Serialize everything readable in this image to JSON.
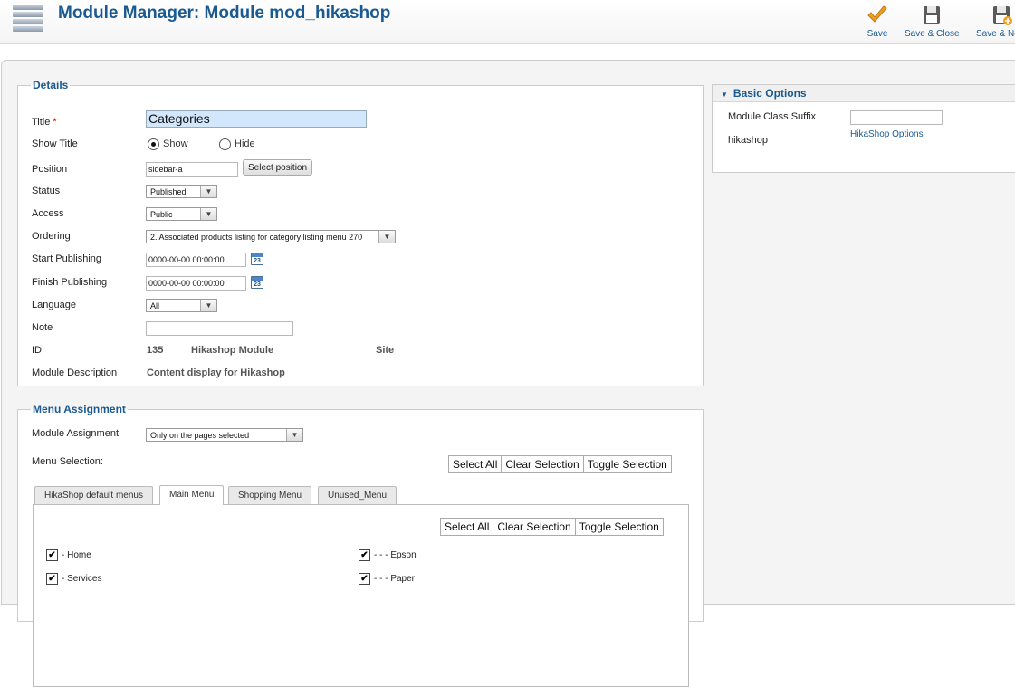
{
  "header": {
    "title": "Module Manager: Module mod_hikashop",
    "toolbar": {
      "save": "Save",
      "save_close": "Save & Close",
      "save_new": "Save & New"
    }
  },
  "details": {
    "legend": "Details",
    "title_label": "Title",
    "required_mark": "*",
    "title_value": "Categories",
    "show_title_label": "Show Title",
    "show_option": "Show",
    "hide_option": "Hide",
    "show_title_selected": "Show",
    "position_label": "Position",
    "position_value": "sidebar-a",
    "select_position_button": "Select position",
    "status_label": "Status",
    "status_value": "Published",
    "access_label": "Access",
    "access_value": "Public",
    "ordering_label": "Ordering",
    "ordering_value": "2. Associated products listing for category listing menu 270",
    "start_publishing_label": "Start Publishing",
    "start_publishing_value": "0000-00-00 00:00:00",
    "finish_publishing_label": "Finish Publishing",
    "finish_publishing_value": "0000-00-00 00:00:00",
    "calendar_day": "23",
    "language_label": "Language",
    "language_value": "All",
    "note_label": "Note",
    "note_value": "",
    "id_label": "ID",
    "id_value": "135",
    "module_name": "Hikashop Module",
    "module_client": "Site",
    "description_label": "Module Description",
    "description_value": "Content display for Hikashop"
  },
  "menu_assignment": {
    "legend": "Menu Assignment",
    "module_assignment_label": "Module Assignment",
    "module_assignment_value": "Only on the pages selected",
    "menu_selection_label": "Menu Selection:",
    "select_all": "Select All",
    "clear_selection": "Clear Selection",
    "toggle_selection": "Toggle Selection",
    "tabs": [
      {
        "label": "HikaShop default menus",
        "active": false
      },
      {
        "label": "Main Menu",
        "active": true
      },
      {
        "label": "Shopping Menu",
        "active": false
      },
      {
        "label": "Unused_Menu",
        "active": false
      }
    ],
    "items": [
      {
        "label": "- Home",
        "checked": true
      },
      {
        "label": "- - - Epson",
        "checked": true
      },
      {
        "label": "- Services",
        "checked": true
      },
      {
        "label": "- - - Paper",
        "checked": true
      }
    ]
  },
  "basic_options": {
    "title": "Basic Options",
    "class_suffix_label": "Module Class Suffix",
    "class_suffix_value": "",
    "hikashop_label": "hikashop",
    "hikashop_link": "HikaShop Options"
  },
  "colors": {
    "accent": "#1a5a91",
    "title_input_bg": "#d2e7fb",
    "save_check": "#f0a020"
  }
}
